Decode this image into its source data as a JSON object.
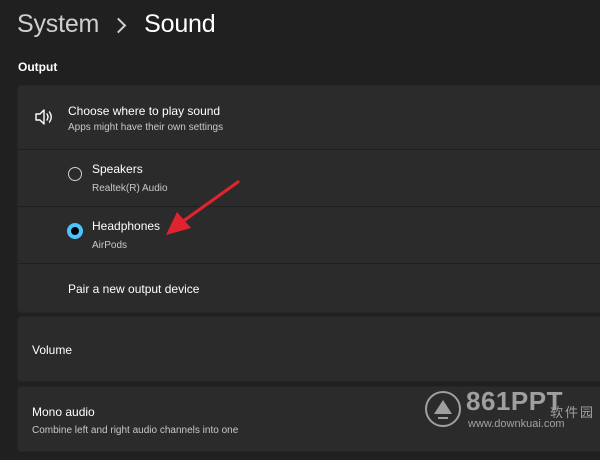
{
  "breadcrumb": {
    "parent": "System",
    "current": "Sound"
  },
  "output": {
    "section_title": "Output",
    "choose": {
      "title": "Choose where to play sound",
      "subtitle": "Apps might have their own settings",
      "icon": "speaker-icon"
    },
    "devices": [
      {
        "name": "Speakers",
        "detail": "Realtek(R) Audio",
        "selected": false
      },
      {
        "name": "Headphones",
        "detail": "AirPods",
        "selected": true
      }
    ],
    "pair_label": "Pair a new output device"
  },
  "volume": {
    "label": "Volume"
  },
  "mono": {
    "title": "Mono audio",
    "subtitle": "Combine left and right audio channels into one"
  },
  "colors": {
    "background": "#202020",
    "card": "#2b2b2b",
    "accent": "#4cc2ff",
    "arrow": "#e0242f"
  },
  "watermark": {
    "brand": "861PPT",
    "chinese": "软件园",
    "url": "www.downkuai.com"
  }
}
